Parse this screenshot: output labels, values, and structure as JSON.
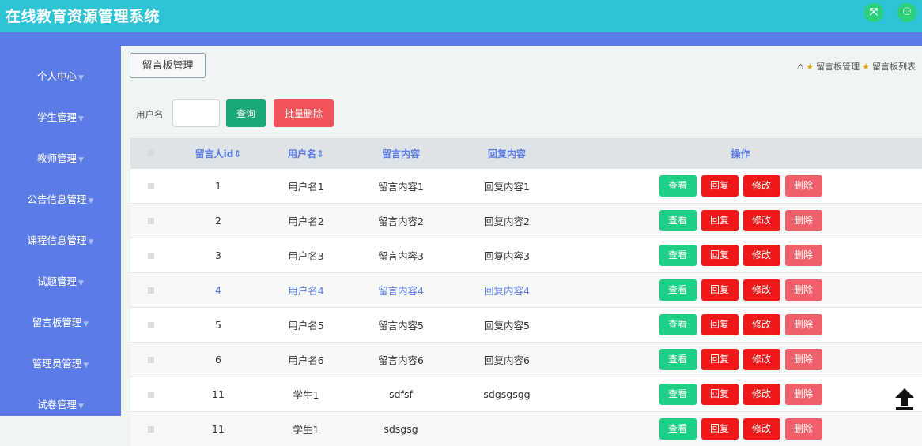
{
  "header": {
    "title": "在线教育资源管理系统",
    "icons": [
      "fullscreen-icon",
      "user-icon"
    ]
  },
  "sidebar": {
    "items": [
      {
        "label": "个人中心"
      },
      {
        "label": "学生管理"
      },
      {
        "label": "教师管理"
      },
      {
        "label": "公告信息管理"
      },
      {
        "label": "课程信息管理"
      },
      {
        "label": "试题管理"
      },
      {
        "label": "留言板管理"
      },
      {
        "label": "管理员管理"
      },
      {
        "label": "试卷管理"
      }
    ]
  },
  "main": {
    "tab_label": "留言板管理",
    "breadcrumb": [
      "留言板管理",
      "留言板列表"
    ],
    "search": {
      "label": "用户名",
      "value": "",
      "query_button": "查询",
      "batch_delete_button": "批量删除"
    },
    "table": {
      "columns": [
        "留言人id",
        "用户名",
        "留言内容",
        "回复内容",
        "操作"
      ],
      "actions": [
        "查看",
        "回复",
        "修改",
        "删除"
      ],
      "rows": [
        {
          "id": "1",
          "username": "用户名1",
          "content": "留言内容1",
          "reply": "回复内容1"
        },
        {
          "id": "2",
          "username": "用户名2",
          "content": "留言内容2",
          "reply": "回复内容2"
        },
        {
          "id": "3",
          "username": "用户名3",
          "content": "留言内容3",
          "reply": "回复内容3"
        },
        {
          "id": "4",
          "username": "用户名4",
          "content": "留言内容4",
          "reply": "回复内容4"
        },
        {
          "id": "5",
          "username": "用户名5",
          "content": "留言内容5",
          "reply": "回复内容5"
        },
        {
          "id": "6",
          "username": "用户名6",
          "content": "留言内容6",
          "reply": "回复内容6"
        },
        {
          "id": "11",
          "username": "学生1",
          "content": "sdfsf",
          "reply": "sdgsgsgg"
        },
        {
          "id": "11",
          "username": "学生1",
          "content": "sdsgsg",
          "reply": ""
        }
      ]
    }
  },
  "colors": {
    "header_bg": "#2ec4d6",
    "sidebar_bg": "#5b7be6",
    "view_btn": "#1fcf86",
    "reply_btn": "#f01818",
    "edit_btn": "#f01818",
    "delete_btn": "#f0606a",
    "query_btn": "#1aa879",
    "batch_delete_btn": "#f15358"
  }
}
